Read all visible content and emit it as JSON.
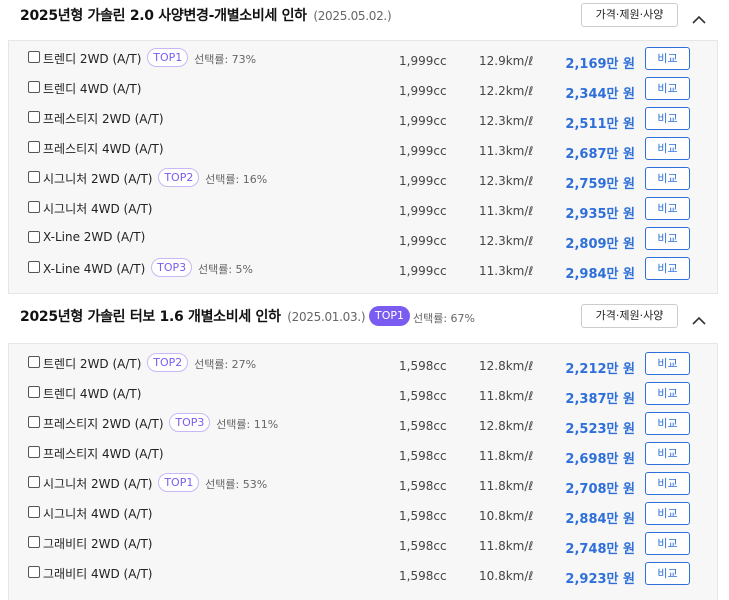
{
  "sections": [
    {
      "title": "2025년형 가솔린 2.0 사양변경-개별소비세 인하",
      "date": "(2025.05.02.)",
      "badge": "",
      "badge_rate": "",
      "spec_button": "가격·제원·사양",
      "rows": [
        {
          "trim": "트렌디 2WD (A/T)",
          "tag": "TOP1",
          "rate": "선택률: 73%",
          "cc": "1,999cc",
          "eff": "12.9km/ℓ",
          "price": "2,169만 원",
          "compare": "비교"
        },
        {
          "trim": "트렌디 4WD (A/T)",
          "tag": "",
          "rate": "",
          "cc": "1,999cc",
          "eff": "12.2km/ℓ",
          "price": "2,344만 원",
          "compare": "비교"
        },
        {
          "trim": "프레스티지 2WD (A/T)",
          "tag": "",
          "rate": "",
          "cc": "1,999cc",
          "eff": "12.3km/ℓ",
          "price": "2,511만 원",
          "compare": "비교"
        },
        {
          "trim": "프레스티지 4WD (A/T)",
          "tag": "",
          "rate": "",
          "cc": "1,999cc",
          "eff": "11.3km/ℓ",
          "price": "2,687만 원",
          "compare": "비교"
        },
        {
          "trim": "시그니처 2WD (A/T)",
          "tag": "TOP2",
          "rate": "선택률: 16%",
          "cc": "1,999cc",
          "eff": "12.3km/ℓ",
          "price": "2,759만 원",
          "compare": "비교"
        },
        {
          "trim": "시그니처 4WD (A/T)",
          "tag": "",
          "rate": "",
          "cc": "1,999cc",
          "eff": "11.3km/ℓ",
          "price": "2,935만 원",
          "compare": "비교"
        },
        {
          "trim": "X-Line 2WD (A/T)",
          "tag": "",
          "rate": "",
          "cc": "1,999cc",
          "eff": "12.3km/ℓ",
          "price": "2,809만 원",
          "compare": "비교"
        },
        {
          "trim": "X-Line 4WD (A/T)",
          "tag": "TOP3",
          "rate": "선택률: 5%",
          "cc": "1,999cc",
          "eff": "11.3km/ℓ",
          "price": "2,984만 원",
          "compare": "비교"
        }
      ]
    },
    {
      "title": "2025년형 가솔린 터보 1.6 개별소비세 인하",
      "date": "(2025.01.03.)",
      "badge": "TOP1",
      "badge_rate": "선택률: 67%",
      "spec_button": "가격·제원·사양",
      "rows": [
        {
          "trim": "트렌디 2WD (A/T)",
          "tag": "TOP2",
          "rate": "선택률: 27%",
          "cc": "1,598cc",
          "eff": "12.8km/ℓ",
          "price": "2,212만 원",
          "compare": "비교"
        },
        {
          "trim": "트렌디 4WD (A/T)",
          "tag": "",
          "rate": "",
          "cc": "1,598cc",
          "eff": "11.8km/ℓ",
          "price": "2,387만 원",
          "compare": "비교"
        },
        {
          "trim": "프레스티지 2WD (A/T)",
          "tag": "TOP3",
          "rate": "선택률: 11%",
          "cc": "1,598cc",
          "eff": "12.8km/ℓ",
          "price": "2,523만 원",
          "compare": "비교"
        },
        {
          "trim": "프레스티지 4WD (A/T)",
          "tag": "",
          "rate": "",
          "cc": "1,598cc",
          "eff": "11.8km/ℓ",
          "price": "2,698만 원",
          "compare": "비교"
        },
        {
          "trim": "시그니처 2WD (A/T)",
          "tag": "TOP1",
          "rate": "선택률: 53%",
          "cc": "1,598cc",
          "eff": "11.8km/ℓ",
          "price": "2,708만 원",
          "compare": "비교"
        },
        {
          "trim": "시그니처 4WD (A/T)",
          "tag": "",
          "rate": "",
          "cc": "1,598cc",
          "eff": "10.8km/ℓ",
          "price": "2,884만 원",
          "compare": "비교"
        },
        {
          "trim": "그래비티 2WD (A/T)",
          "tag": "",
          "rate": "",
          "cc": "1,598cc",
          "eff": "11.8km/ℓ",
          "price": "2,748만 원",
          "compare": "비교"
        },
        {
          "trim": "그래비티 4WD (A/T)",
          "tag": "",
          "rate": "",
          "cc": "1,598cc",
          "eff": "10.8km/ℓ",
          "price": "2,923만 원",
          "compare": "비교"
        }
      ]
    }
  ],
  "colors": {
    "accent": "#2e6fd9",
    "badge": "#7a5df0",
    "tag_border": "#c9b8f5"
  },
  "icons": {
    "collapse": "chevron-up-icon"
  }
}
